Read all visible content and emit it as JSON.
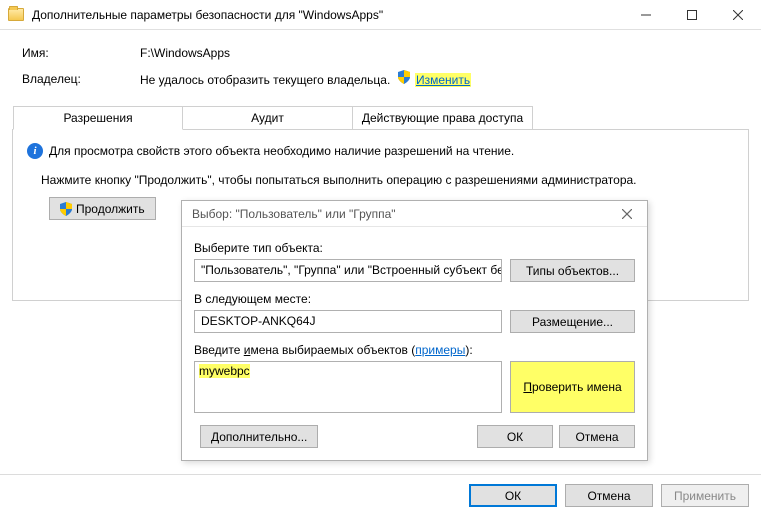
{
  "window": {
    "title": "Дополнительные параметры безопасности для \"WindowsApps\""
  },
  "header": {
    "name_label": "Имя:",
    "name_value": "F:\\WindowsApps",
    "owner_label": "Владелец:",
    "owner_value": "Не удалось отобразить текущего владельца.",
    "change_link": "Изменить"
  },
  "tabs": {
    "permissions": "Разрешения",
    "audit": "Аудит",
    "effective": "Действующие права доступа"
  },
  "panel": {
    "info_text": "Для просмотра свойств этого объекта необходимо наличие разрешений на чтение.",
    "instruction": "Нажмите кнопку \"Продолжить\", чтобы попытаться выполнить операцию с разрешениями администратора.",
    "continue_btn": "Продолжить"
  },
  "dialog": {
    "title": "Выбор: \"Пользователь\" или \"Группа\"",
    "obj_type_label": "Выберите тип объекта:",
    "obj_type_value": "\"Пользователь\", \"Группа\" или \"Встроенный субъект безопасности\"",
    "obj_types_btn": "Типы объектов...",
    "location_label": "В следующем месте:",
    "location_value": "DESKTOP-ANKQ64J",
    "location_btn": "Размещение...",
    "enter_label_prefix": "Введите ",
    "enter_label_u": "и",
    "enter_label_mid": "мена выбираемых объектов (",
    "enter_label_link": "примеры",
    "enter_label_suffix": "):",
    "object_name": "mywebpc",
    "check_names_btn": "Проверить имена",
    "advanced_btn": "Дополнительно...",
    "ok_btn": "ОК",
    "cancel_btn": "Отмена"
  },
  "footer": {
    "ok": "ОК",
    "cancel": "Отмена",
    "apply": "Применить"
  }
}
